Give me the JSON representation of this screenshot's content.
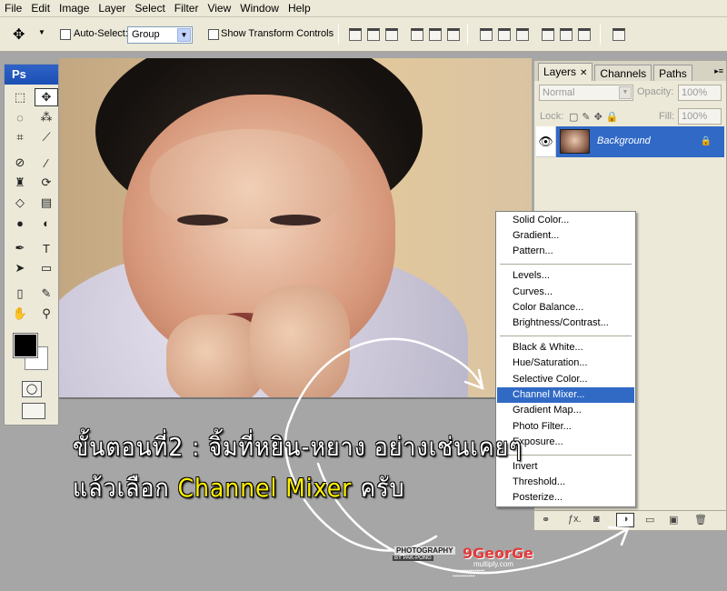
{
  "menubar": [
    "File",
    "Edit",
    "Image",
    "Layer",
    "Select",
    "Filter",
    "View",
    "Window",
    "Help"
  ],
  "options": {
    "auto_select_label": "Auto-Select:",
    "auto_select_value": "Group",
    "show_transform_label": "Show Transform Controls"
  },
  "toolbox": {
    "logo": "Ps"
  },
  "layers_panel": {
    "tabs": [
      "Layers",
      "Channels",
      "Paths"
    ],
    "blend_mode": "Normal",
    "opacity_label": "Opacity:",
    "opacity_value": "100%",
    "lock_label": "Lock:",
    "fill_label": "Fill:",
    "fill_value": "100%",
    "layer_name": "Background"
  },
  "adjustment_menu": {
    "groups": [
      [
        "Solid Color...",
        "Gradient...",
        "Pattern..."
      ],
      [
        "Levels...",
        "Curves...",
        "Color Balance...",
        "Brightness/Contrast..."
      ],
      [
        "Black & White...",
        "Hue/Saturation...",
        "Selective Color...",
        "Channel Mixer...",
        "Gradient Map...",
        "Photo Filter...",
        "Exposure..."
      ],
      [
        "Invert",
        "Threshold...",
        "Posterize..."
      ]
    ],
    "highlighted": "Channel Mixer..."
  },
  "caption": {
    "line1": "ขั้นตอนที่2 : จิ้มที่หยิน-หยาง อย่างเช่นเคยๆ",
    "line2_pre": "แล้วเลือก ",
    "line2_hl": "Channel Mixer",
    "line2_post": " ครับ"
  },
  "watermark": {
    "photography": "PHOTOGRAPHY",
    "sub": "BY PAK-PONG",
    "logo": "9GeorGe",
    "site": "multiply.com"
  },
  "colors": {
    "accent": "#316ac5",
    "caption_highlight": "#fff000",
    "panel_bg": "#ece9d8"
  }
}
